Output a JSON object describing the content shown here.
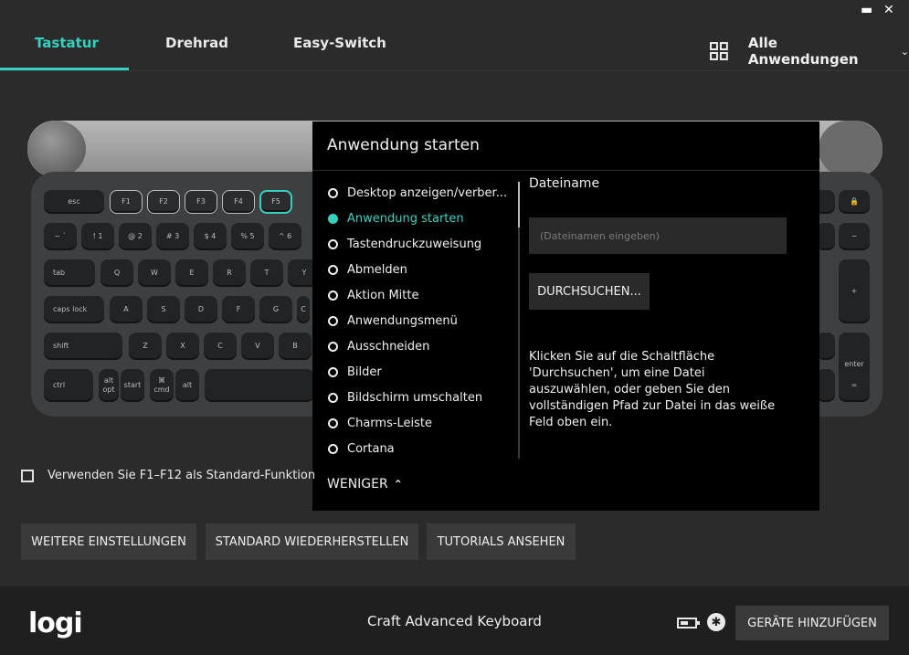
{
  "window": {
    "minimize_glyph": "▬",
    "close_glyph": "✕"
  },
  "tabs": [
    {
      "label": "Tastatur",
      "active": true
    },
    {
      "label": "Drehrad",
      "active": false
    },
    {
      "label": "Easy-Switch",
      "active": false
    }
  ],
  "app_selector": {
    "label": "Alle Anwendungen",
    "icon": "grid-icon"
  },
  "keyboard": {
    "rows": [
      [
        "esc",
        "F1",
        "F2",
        "F3",
        "F4",
        "F5"
      ],
      [
        "~ `",
        "! 1",
        "@ 2",
        "# 3",
        "$ 4",
        "% 5",
        "^ 6"
      ],
      [
        "tab",
        "Q",
        "W",
        "E",
        "R",
        "T",
        "Y"
      ],
      [
        "caps lock",
        "A",
        "S",
        "D",
        "F",
        "G",
        "C"
      ],
      [
        "shift",
        "Z",
        "X",
        "C",
        "V",
        "B"
      ],
      [
        "ctrl",
        "alt opt",
        "start",
        "⌘ cmd",
        "alt"
      ]
    ],
    "right_keys": [
      "−",
      "+",
      "enter",
      "="
    ]
  },
  "popup": {
    "title": "Anwendung starten",
    "options": [
      {
        "label": "Desktop anzeigen/verber...",
        "selected": false
      },
      {
        "label": "Anwendung starten",
        "selected": true
      },
      {
        "label": "Tastendruckzuweisung",
        "selected": false
      },
      {
        "label": "Abmelden",
        "selected": false
      },
      {
        "label": "Aktion Mitte",
        "selected": false
      },
      {
        "label": "Anwendungsmenü",
        "selected": false
      },
      {
        "label": "Ausschneiden",
        "selected": false
      },
      {
        "label": "Bilder",
        "selected": false
      },
      {
        "label": "Bildschirm umschalten",
        "selected": false
      },
      {
        "label": "Charms-Leiste",
        "selected": false
      },
      {
        "label": "Cortana",
        "selected": false
      }
    ],
    "field_label": "Dateiname",
    "field_placeholder": "(Dateinamen eingeben)",
    "browse_label": "DURCHSUCHEN...",
    "hint": "Klicken Sie auf die Schaltfläche 'Durchsuchen', um eine Datei auszuwählen, oder geben Sie den vollständigen Pfad zur Datei in das weiße Feld oben ein.",
    "less_label": "WENIGER",
    "less_glyph": "⌃"
  },
  "fkey_checkbox": {
    "label": "Verwenden Sie F1–F12 als Standard-Funktion",
    "checked": false
  },
  "buttons": {
    "more_settings": "WEITERE EINSTELLUNGEN",
    "restore_defaults": "STANDARD WIEDERHERSTELLEN",
    "tutorials": "TUTORIALS ANSEHEN"
  },
  "footer": {
    "logo": "logi",
    "device_name": "Craft Advanced Keyboard",
    "battery_icon": "battery-icon",
    "bluetooth_icon": "bluetooth-icon",
    "bluetooth_glyph": "✱",
    "add_devices": "GERÄTE HINZUFÜGEN"
  }
}
